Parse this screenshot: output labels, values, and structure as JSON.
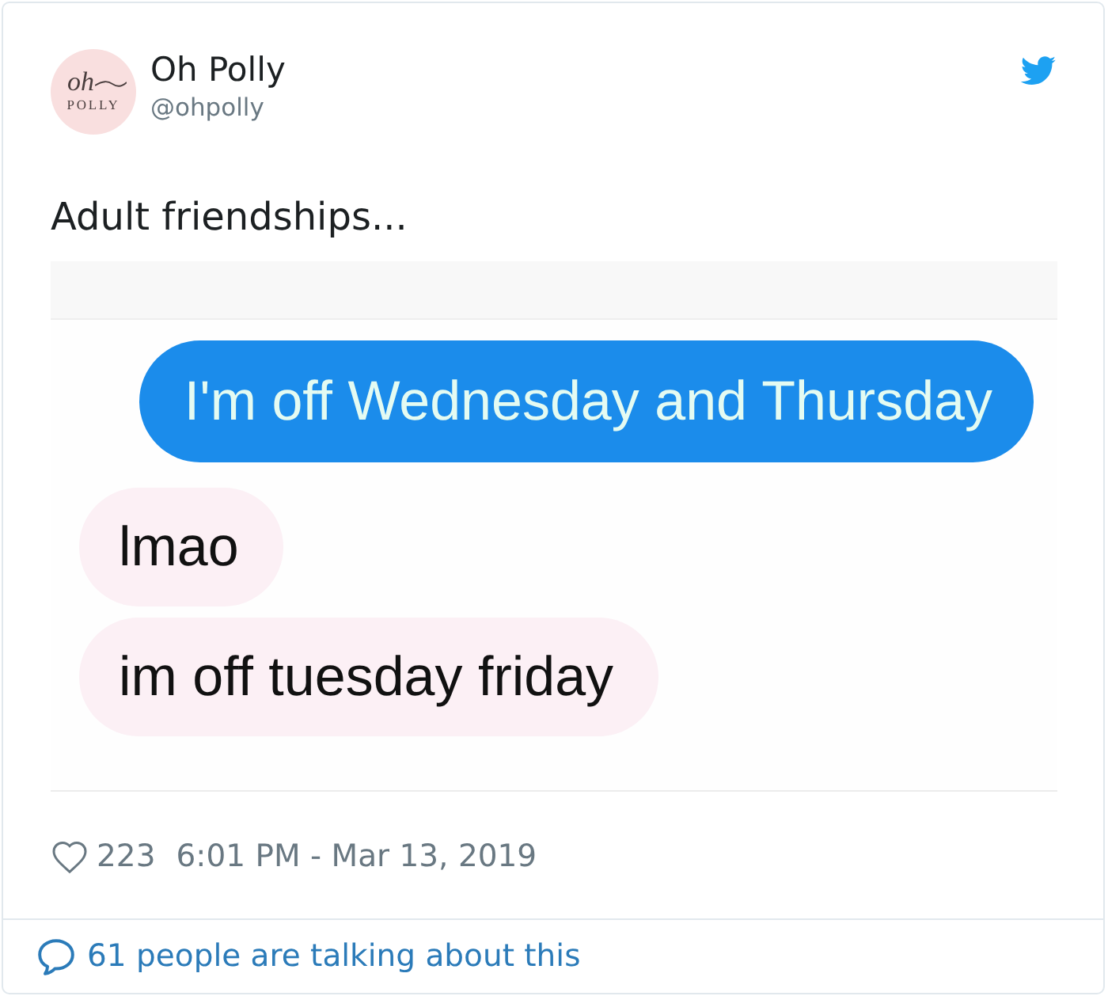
{
  "tweet": {
    "author": {
      "avatar": {
        "script": "oh",
        "wordmark": "POLLY"
      },
      "name": "Oh Polly",
      "handle": "@ohpolly"
    },
    "text": "Adult friendships...",
    "image": {
      "messages": [
        {
          "kind": "sent",
          "text": "I'm off Wednesday and Thursday"
        },
        {
          "kind": "received",
          "text": "lmao"
        },
        {
          "kind": "received",
          "text": "im off tuesday friday"
        }
      ]
    },
    "likes": "223",
    "timestamp": "6:01 PM - Mar 13, 2019",
    "conversation": "61 people are talking about this"
  }
}
